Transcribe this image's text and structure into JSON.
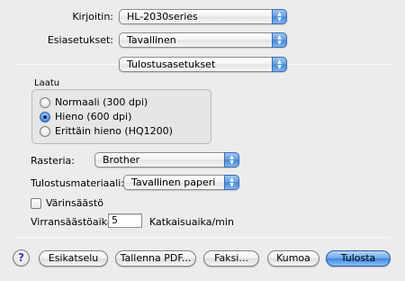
{
  "printer": {
    "label": "Kirjoitin:",
    "value": "HL-2030series"
  },
  "presets": {
    "label": "Esiasetukset:",
    "value": "Tavallinen"
  },
  "panel": {
    "value": "Tulostusasetukset"
  },
  "quality": {
    "title": "Laatu",
    "options": [
      {
        "label": "Normaali (300 dpi)",
        "selected": false
      },
      {
        "label": "Hieno (600 dpi)",
        "selected": true
      },
      {
        "label": "Erittäin hieno (HQ1200)",
        "selected": false
      }
    ]
  },
  "raster": {
    "label": "Rasteria:",
    "value": "Brother"
  },
  "media": {
    "label": "Tulostusmateriaali:",
    "value": "Tavallinen paperi"
  },
  "toner_save": {
    "label": "Värinsäästö",
    "checked": false
  },
  "sleep": {
    "label": "Virransäästöaika:",
    "value": "5",
    "unit": "Katkaisuaika/min"
  },
  "buttons": {
    "help": "?",
    "preview": "Esikatselu",
    "save_pdf": "Tallenna PDF...",
    "fax": "Faksi...",
    "cancel": "Kumoa",
    "print": "Tulosta"
  }
}
